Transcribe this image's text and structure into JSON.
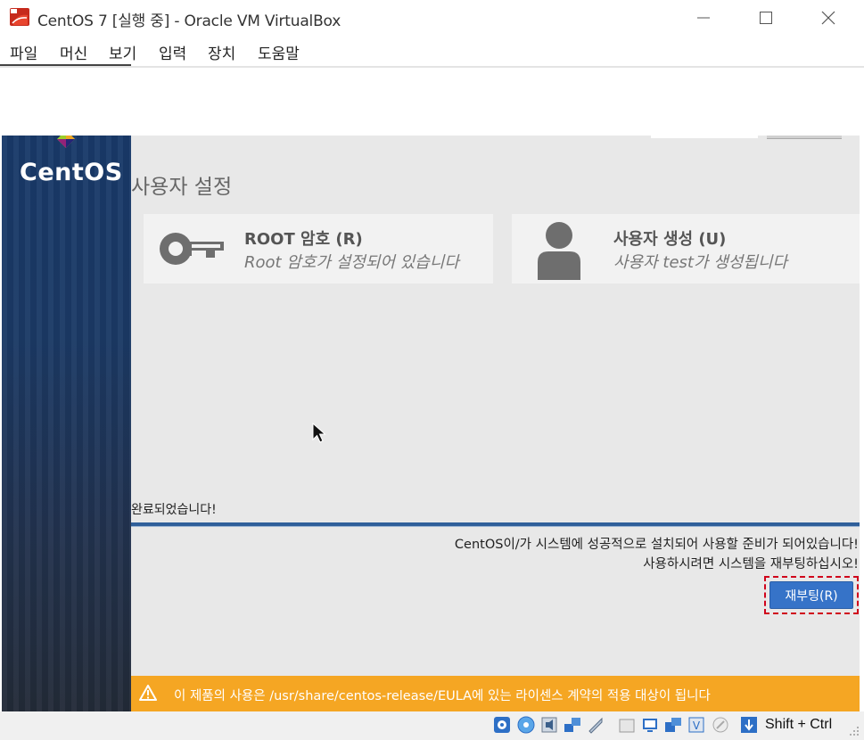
{
  "window": {
    "title": "CentOS 7 [실행 중] - Oracle VM VirtualBox",
    "icon": "virtualbox-vm-icon"
  },
  "menu": [
    "파일",
    "머신",
    "보기",
    "입력",
    "장치",
    "도움말"
  ],
  "installer": {
    "brand": "CentOS",
    "section_title": "사용자 설정",
    "root_tile": {
      "title": "ROOT 암호 (R)",
      "status": "Root 암호가 설정되어 있습니다",
      "icon": "key-icon"
    },
    "user_tile": {
      "title": "사용자 생성 (U)",
      "status": "사용자 test가 생성됩니다",
      "icon": "user-icon"
    },
    "complete_label": "완료되었습니다!",
    "progress": 1.0,
    "message_line1": "CentOS이/가 시스템에 성공적으로 설치되어 사용할 준비가 되어있습니다!",
    "message_line2": "사용하시려면 시스템을 재부팅하십시오!",
    "reboot_button": "재부팅(R)",
    "eula_notice": "이 제품의 사용은 /usr/share/centos-release/EULA에 있는 라이센스 계약의 적용 대상이 됩니다"
  },
  "statusbar": {
    "host_key": "Shift + Ctrl",
    "icons": [
      "hard-disk-icon",
      "optical-drive-icon",
      "audio-icon",
      "network-icon",
      "usb-icon",
      "shared-folder-icon",
      "display-icon",
      "video-capture-icon",
      "vt-x-icon",
      "mouse-integration-icon",
      "keyboard-capture-icon"
    ]
  },
  "colors": {
    "sidebar": "#1b3a66",
    "reboot_button": "#3673c8",
    "eula_bar": "#f5a623",
    "highlight": "#d0021b"
  }
}
